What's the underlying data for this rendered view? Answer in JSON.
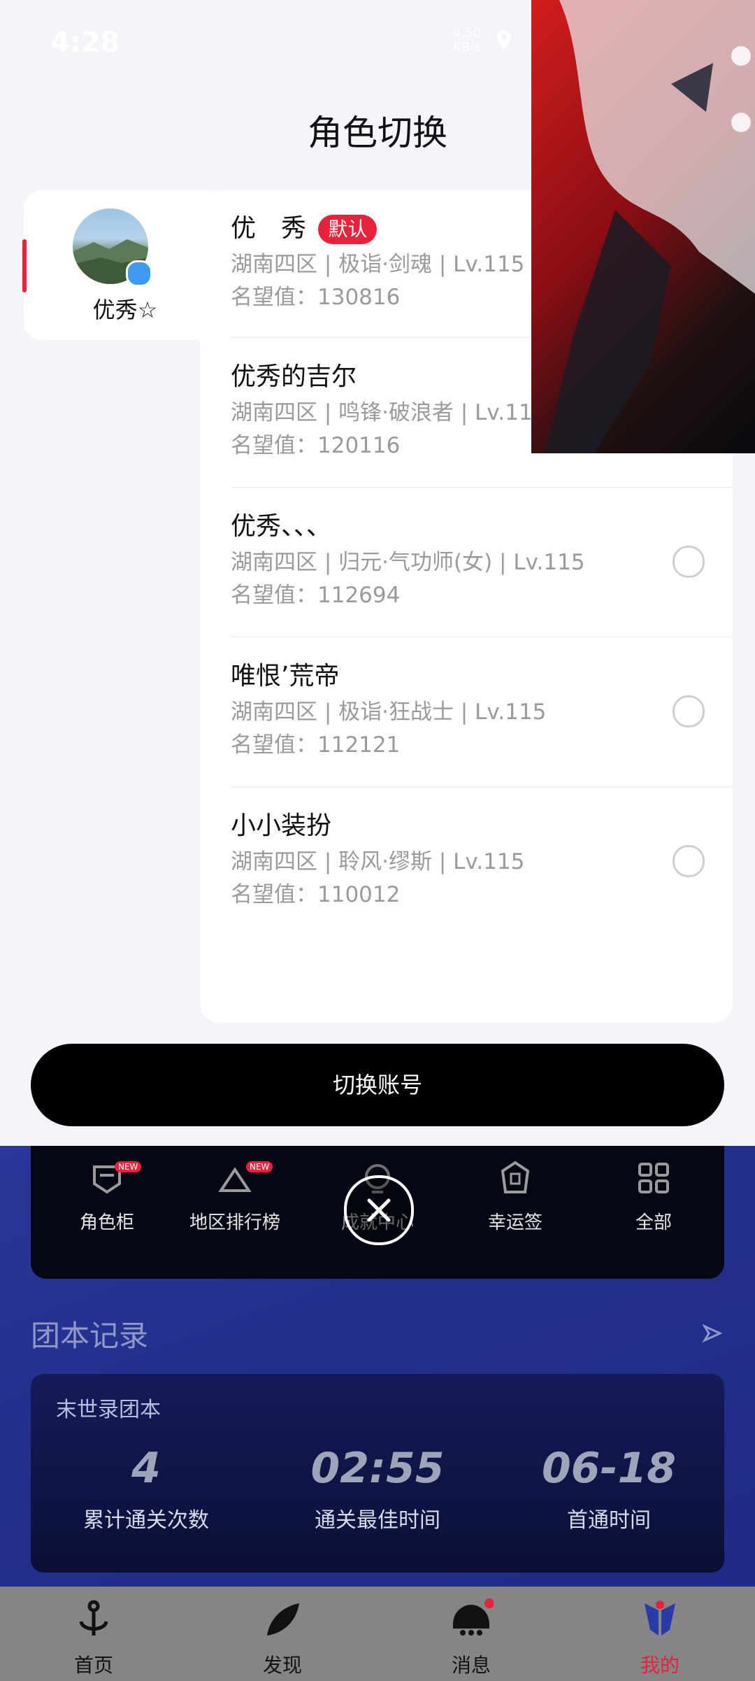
{
  "status_bar": {
    "time": "4:28",
    "net_rate": "4.50",
    "net_unit": "KB/s"
  },
  "header": {
    "title": "角色切换"
  },
  "account": {
    "name": "优秀☆"
  },
  "roles": [
    {
      "name": "优　秀",
      "badge": "默认",
      "meta": "湖南四区 | 极诣·剑魂 | Lv.115",
      "reputation": "名望值：130816"
    },
    {
      "name": "优秀的吉尔",
      "meta": "湖南四区 | 鸣锋·破浪者 | Lv.115",
      "reputation": "名望值：120116"
    },
    {
      "name": "优秀、、、",
      "meta": "湖南四区 | 归元·气功师(女) | Lv.115",
      "reputation": "名望值：112694"
    },
    {
      "name": "唯恨’荒帝",
      "meta": "湖南四区 | 极诣·狂战士 | Lv.115",
      "reputation": "名望值：112121"
    },
    {
      "name": "小小装扮",
      "meta": "湖南四区 | 聆风·缪斯 | Lv.115",
      "reputation": "名望值：110012"
    }
  ],
  "switch_button": {
    "label": "切换账号"
  },
  "quick_bar": {
    "items": [
      {
        "label": "角色柜",
        "new": "NEW"
      },
      {
        "label": "地区排行榜",
        "new": "NEW"
      },
      {
        "label": "成就中心"
      },
      {
        "label": "幸运签"
      },
      {
        "label": "全部"
      }
    ]
  },
  "raid": {
    "title": "团本记录",
    "card_title": "末世录团本",
    "stats": [
      {
        "value": "4",
        "label": "累计通关次数"
      },
      {
        "value": "02:55",
        "label": "通关最佳时间"
      },
      {
        "value": "06-18",
        "label": "首通时间"
      }
    ]
  },
  "tabbar": {
    "items": [
      {
        "label": "首页"
      },
      {
        "label": "发现"
      },
      {
        "label": "消息"
      },
      {
        "label": "我的"
      }
    ]
  },
  "colors": {
    "accent": "#e8223a",
    "button": "#000000",
    "page_bg": "#f3f5fb"
  }
}
